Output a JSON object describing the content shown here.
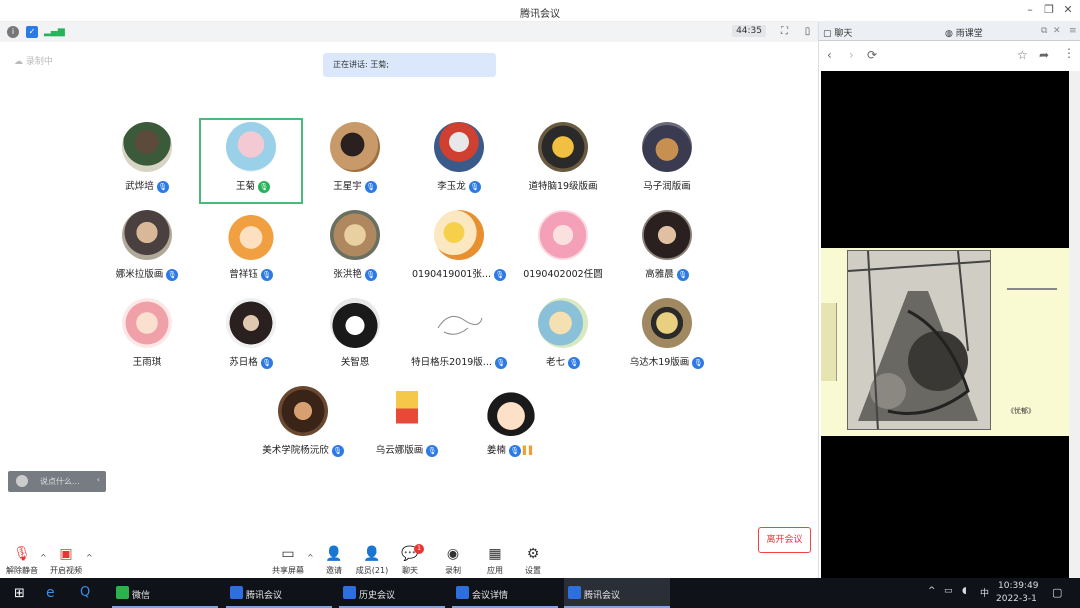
{
  "window": {
    "title": "腾讯会议"
  },
  "status_bar": {
    "timer": "44:35"
  },
  "cloud_label": "录制中",
  "speaking_text": "正在讲话: 王菊;",
  "participants": [
    {
      "name": "武烨培",
      "mic": "blue"
    },
    {
      "name": "王菊",
      "mic": "green",
      "active": true
    },
    {
      "name": "王星宇",
      "mic": "blue"
    },
    {
      "name": "李玉龙",
      "mic": "blue"
    },
    {
      "name": "道特脑19级版画",
      "mic": "none"
    },
    {
      "name": "马子润版画",
      "mic": "none"
    },
    {
      "name": "娜米拉版画",
      "mic": "blue"
    },
    {
      "name": "曾祥钰",
      "mic": "blue"
    },
    {
      "name": "张洪艳",
      "mic": "blue"
    },
    {
      "name": "0190419001张...",
      "mic": "blue"
    },
    {
      "name": "0190402002任圆",
      "mic": "none"
    },
    {
      "name": "高雅晨",
      "mic": "blue"
    },
    {
      "name": "王雨琪",
      "mic": "none"
    },
    {
      "name": "苏日格",
      "mic": "blue"
    },
    {
      "name": "关智恩",
      "mic": "none"
    },
    {
      "name": "特日格乐2019版...",
      "mic": "blue"
    },
    {
      "name": "老七",
      "mic": "blue"
    },
    {
      "name": "乌达木19版画",
      "mic": "blue"
    },
    {
      "name": "美术学院杨沅欣",
      "mic": "blue"
    },
    {
      "name": "乌云娜版画",
      "mic": "blue"
    },
    {
      "name": "姜楠",
      "mic": "blue",
      "bars": true
    }
  ],
  "chat_input": {
    "placeholder": "说点什么..."
  },
  "toolbar": {
    "unmute": "解除静音",
    "start_video": "开启视频",
    "share_screen": "共享屏幕",
    "invite": "邀请",
    "members": "成员(21)",
    "chat": "聊天",
    "chat_badge": "1",
    "record": "录制",
    "apps": "应用",
    "settings": "设置",
    "leave": "离开会议"
  },
  "right_panel": {
    "tab_chat": "聊天",
    "tab_rain": "雨课堂",
    "slide_caption": "《忧郁》"
  },
  "taskbar": {
    "apps": [
      {
        "label": "微信"
      },
      {
        "label": "腾讯会议"
      },
      {
        "label": "历史会议"
      },
      {
        "label": "会议详情"
      },
      {
        "label": "腾讯会议"
      }
    ],
    "ime": "中",
    "time": "10:39:49",
    "date": "2022-3-1"
  },
  "colors": {
    "accent": "#2b7ae6",
    "active_border": "#4cb87a",
    "leave": "#e33333"
  }
}
